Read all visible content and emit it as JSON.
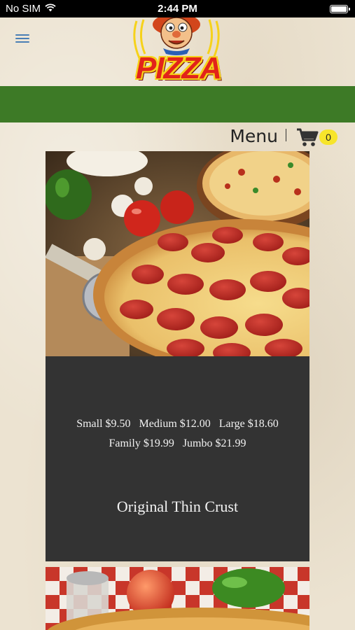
{
  "status_bar": {
    "carrier": "No SIM",
    "time": "2:44 PM"
  },
  "header": {
    "logo_text": "PIZZA",
    "band_color": "#3d7a26"
  },
  "menu_row": {
    "title": "Menu",
    "cart_count": "0",
    "badge_color": "#f7e52b"
  },
  "products": [
    {
      "image": "pepperoni-pizza-photo",
      "prices_line1": [
        "Small $9.50",
        "Medium $12.00",
        "Large $18.60"
      ],
      "prices_line2": [
        "Family $19.99",
        "Jumbo $21.99"
      ],
      "name": "Original Thin Crust"
    },
    {
      "image": "deep-dish-pizza-photo"
    }
  ],
  "icons": {
    "menu": "hamburger-icon",
    "cart": "cart-icon",
    "wifi": "wifi-icon",
    "battery": "battery-icon"
  }
}
